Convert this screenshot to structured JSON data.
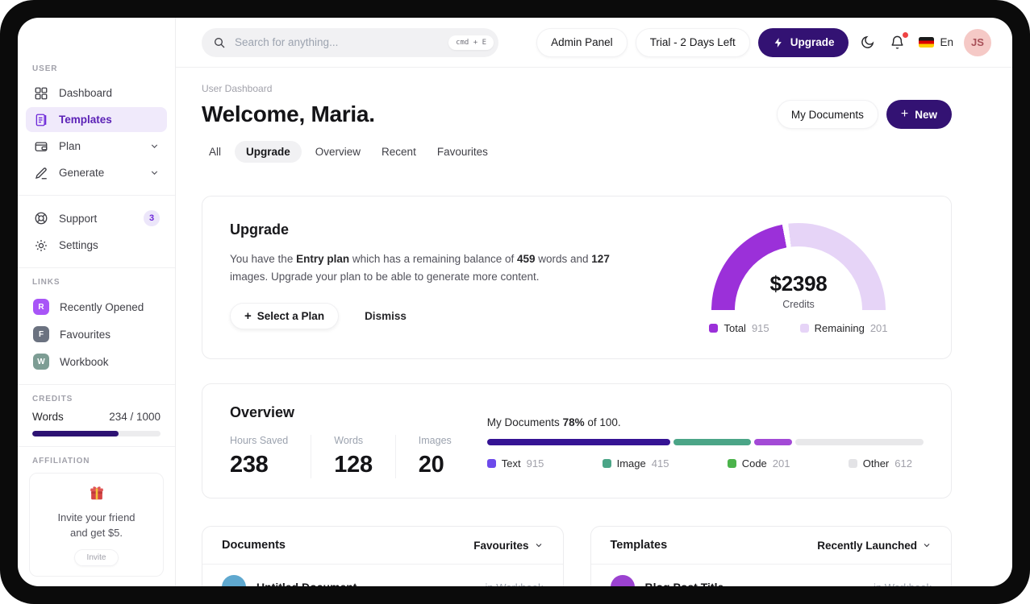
{
  "colors": {
    "accent": "#331273",
    "credits_fill": "#2d1273",
    "noti_dot": "#ef4444",
    "link_r": "#a855f7",
    "link_f": "#6b7280",
    "link_w": "#7d9d94",
    "doc_avatar": "#5fa8cf",
    "tpl_avatar": "#9b42d0"
  },
  "sidebar": {
    "user_label": "USER",
    "items": [
      {
        "label": "Dashboard"
      },
      {
        "label": "Templates"
      },
      {
        "label": "Plan"
      },
      {
        "label": "Generate"
      }
    ],
    "support": "Support",
    "support_badge": "3",
    "settings": "Settings",
    "links_label": "LINKS",
    "links": [
      {
        "initial": "R",
        "label": "Recently Opened"
      },
      {
        "initial": "F",
        "label": "Favourites"
      },
      {
        "initial": "W",
        "label": "Workbook"
      }
    ],
    "credits_label": "CREDITS",
    "credits_name": "Words",
    "credits_value": "234 / 1000",
    "credits_pct": 67,
    "affiliation_label": "AFFILIATION",
    "affiliation_line1": "Invite your friend",
    "affiliation_line2": "and get $5.",
    "invite_button": "Invite"
  },
  "topbar": {
    "search_placeholder": "Search for anything...",
    "search_kbd": "cmd + E",
    "admin_panel": "Admin Panel",
    "trial": "Trial - 2 Days Left",
    "upgrade": "Upgrade",
    "lang": "En",
    "avatar_initials": "JS"
  },
  "header": {
    "breadcrumb": "User Dashboard",
    "title": "Welcome, Maria.",
    "tabs": [
      "All",
      "Upgrade",
      "Overview",
      "Recent",
      "Favourites"
    ],
    "active_tab": "Upgrade",
    "my_documents": "My Documents",
    "new_button": "New"
  },
  "upgrade_card": {
    "title": "Upgrade",
    "body_pre": "You have the ",
    "plan": "Entry plan",
    "body_mid1": " which has a remaining balance of ",
    "words": "459",
    "body_mid2": " words and ",
    "images": "127",
    "body_post": " images. Upgrade your plan to be able to generate more content.",
    "select_plan": "Select a Plan",
    "dismiss": "Dismiss"
  },
  "chart_data": [
    {
      "type": "pie",
      "variant": "half-donut-gauge",
      "center_value": "$2398",
      "center_caption": "Credits",
      "gap_deg": 4,
      "legend_position": "bottom",
      "series": [
        {
          "name": "Total",
          "value": 915,
          "pct": 44,
          "color": "#9b30d9"
        },
        {
          "name": "Remaining",
          "value": 201,
          "pct": 54,
          "color": "#e6d4f7"
        }
      ]
    },
    {
      "type": "bar",
      "variant": "stacked-progress",
      "title": "My Documents 78% of 100.",
      "max": 100,
      "legend_position": "bottom",
      "series": [
        {
          "name": "Text",
          "value": 915,
          "pct": 43,
          "color": "#351394",
          "legend_color": "#6d4aeb"
        },
        {
          "name": "Image",
          "value": 415,
          "pct": 18,
          "color": "#4ba587",
          "legend_color": "#4ba587"
        },
        {
          "name": "Code",
          "value": 201,
          "pct": 9,
          "color": "#a34ad6",
          "legend_color": "#4bb34b"
        },
        {
          "name": "Other",
          "value": 612,
          "pct": 30,
          "color": "#e8e8ea",
          "legend_color": "#e3e3e6"
        }
      ]
    }
  ],
  "overview_card": {
    "title": "Overview",
    "stats": [
      {
        "label": "Hours Saved",
        "value": "238"
      },
      {
        "label": "Words",
        "value": "128"
      },
      {
        "label": "Images",
        "value": "20"
      }
    ],
    "progress_pre": "My Documents ",
    "progress_pct": "78%",
    "progress_post": " of 100."
  },
  "documents_card": {
    "title": "Documents",
    "filter": "Favourites",
    "rows": [
      {
        "title": "Untitled Document",
        "meta": "in Workbook"
      }
    ]
  },
  "templates_card": {
    "title": "Templates",
    "filter": "Recently Launched",
    "rows": [
      {
        "title": "Blog Post Title",
        "meta": "in Workbook"
      }
    ]
  }
}
